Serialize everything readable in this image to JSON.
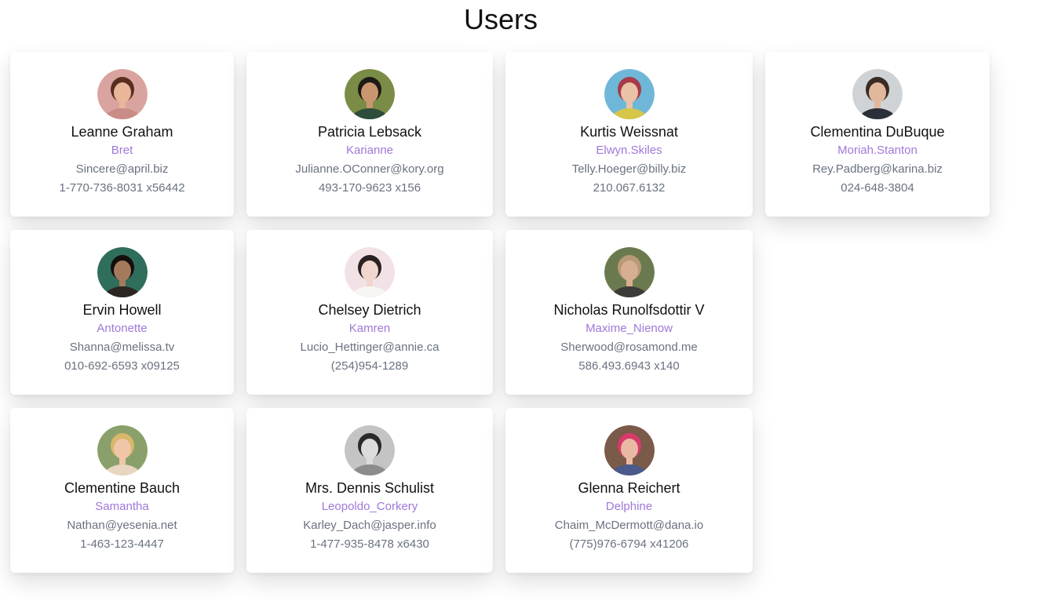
{
  "page": {
    "title": "Users"
  },
  "users": [
    {
      "name": "Leanne Graham",
      "username": "Bret",
      "email": "Sincere@april.biz",
      "phone": "1-770-736-8031 x56442",
      "avatar": {
        "bg": "#d9a4a0",
        "skin": "#e9b69a",
        "hair": "#5a2e1e",
        "shirt": "#c98c86"
      }
    },
    {
      "name": "Patricia Lebsack",
      "username": "Karianne",
      "email": "Julianne.OConner@kory.org",
      "phone": "493-170-9623 x156",
      "avatar": {
        "bg": "#7a8c45",
        "skin": "#c99670",
        "hair": "#1e1a15",
        "shirt": "#2f4d3c"
      }
    },
    {
      "name": "Kurtis Weissnat",
      "username": "Elwyn.Skiles",
      "email": "Telly.Hoeger@billy.biz",
      "phone": "210.067.6132",
      "avatar": {
        "bg": "#6fb7d8",
        "skin": "#eac2a8",
        "hair": "#a83a4a",
        "shirt": "#d6c64a"
      }
    },
    {
      "name": "Clementina DuBuque",
      "username": "Moriah.Stanton",
      "email": "Rey.Padberg@karina.biz",
      "phone": "024-648-3804",
      "avatar": {
        "bg": "#cfd3d6",
        "skin": "#e2b89c",
        "hair": "#3a2c22",
        "shirt": "#2b2f3a"
      }
    },
    {
      "name": "Ervin Howell",
      "username": "Antonette",
      "email": "Shanna@melissa.tv",
      "phone": "010-692-6593 x09125",
      "avatar": {
        "bg": "#2f6d5c",
        "skin": "#a57a5c",
        "hair": "#140f0c",
        "shirt": "#2c2622"
      }
    },
    {
      "name": "Chelsey Dietrich",
      "username": "Kamren",
      "email": "Lucio_Hettinger@annie.ca",
      "phone": "(254)954-1289",
      "avatar": {
        "bg": "#f2e2e6",
        "skin": "#f0d6cc",
        "hair": "#2a2222",
        "shirt": "#f7f4f4"
      }
    },
    {
      "name": "Nicholas Runolfsdottir V",
      "username": "Maxime_Nienow",
      "email": "Sherwood@rosamond.me",
      "phone": "586.493.6943 x140",
      "avatar": {
        "bg": "#6b7a4e",
        "skin": "#d8ae92",
        "hair": "#b89a78",
        "shirt": "#3b3c38"
      }
    },
    {
      "name": "Clementine Bauch",
      "username": "Samantha",
      "email": "Nathan@yesenia.net",
      "phone": "1-463-123-4447",
      "avatar": {
        "bg": "#8aa06a",
        "skin": "#efc6a8",
        "hair": "#d8b66a",
        "shirt": "#e8d6c0"
      }
    },
    {
      "name": "Mrs. Dennis Schulist",
      "username": "Leopoldo_Corkery",
      "email": "Karley_Dach@jasper.info",
      "phone": "1-477-935-8478 x6430",
      "avatar": {
        "bg": "#c4c4c4",
        "skin": "#dcdcdc",
        "hair": "#2a2a2a",
        "shirt": "#8c8c8c"
      }
    },
    {
      "name": "Glenna Reichert",
      "username": "Delphine",
      "email": "Chaim_McDermott@dana.io",
      "phone": "(775)976-6794 x41206",
      "avatar": {
        "bg": "#7a5a48",
        "skin": "#eab9a4",
        "hair": "#d83a6a",
        "shirt": "#4a5a8a"
      }
    }
  ]
}
